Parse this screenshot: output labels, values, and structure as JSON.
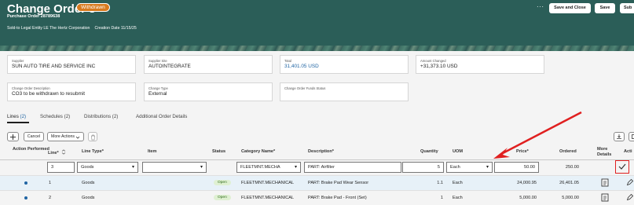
{
  "header": {
    "title": "Change Order 3",
    "badge": "Withdrawn",
    "purchase_order": "Purchase Order 28789638",
    "meta_legal": "Sold-to Legal Entity LE The Hertz Corporation",
    "meta_date": "Creation Date 11/15/25",
    "more_label": "···",
    "save_close_label": "Save and Close",
    "save_label": "Save",
    "submit_label": "Sub"
  },
  "summary": {
    "supplier_label": "Supplier",
    "supplier_value": "SUN AUTO TIRE AND SERVICE INC",
    "site_label": "Supplier Site",
    "site_value": "AUTOINTEGRATE",
    "total_label": "Total",
    "total_value": "31,401.05 USD",
    "amount_label": "Amount Changed",
    "amount_value": "+31,373.10 USD",
    "desc_label": "Change Order Description",
    "desc_value": "CO3 to be withdrawn to resubmit",
    "type_label": "Change Type",
    "type_value": "External",
    "funds_label": "Change Order Funds Status",
    "funds_value": ""
  },
  "tabs": [
    {
      "label": "Lines",
      "count": "(2)"
    },
    {
      "label": "Schedules",
      "count": "(2)"
    },
    {
      "label": "Distributions",
      "count": "(2)"
    },
    {
      "label": "Additional Order Details",
      "count": ""
    }
  ],
  "toolbar": {
    "add_icon": "plus-icon",
    "cancel_label": "Cancel",
    "more_actions_label": "More Actions",
    "delete_icon": "trash-icon"
  },
  "columns": {
    "action_performed": "Action Performed",
    "line": "Line*",
    "line_type": "Line Type*",
    "item": "Item",
    "status": "Status",
    "category": "Category Name*",
    "description": "Description*",
    "quantity": "Quantity",
    "uom": "UOM",
    "price": "Price*",
    "ordered": "Ordered",
    "more_details": "More Details",
    "actions": "Acti"
  },
  "edit_row": {
    "line": "3",
    "line_type": "Goods",
    "item": "",
    "category": "FLEETMNT.MECHA",
    "description": "PART: Airfilter",
    "quantity": "5",
    "uom": "Each",
    "price": "50.00",
    "ordered": "250.00"
  },
  "rows": [
    {
      "line": "1",
      "line_type": "Goods",
      "status": "Open",
      "category": "FLEETMNT.MECHANICAL",
      "description": "PART: Brake Pad Wear Sensor",
      "quantity": "1.1",
      "uom": "Each",
      "price": "24,000.95",
      "ordered": "26,401.05"
    },
    {
      "line": "2",
      "line_type": "Goods",
      "status": "Open",
      "category": "FLEETMNT.MECHANICAL",
      "description": "PART: Brake Pad - Front (Set)",
      "quantity": "1",
      "uom": "Each",
      "price": "5,000.00",
      "ordered": "5,000.00"
    }
  ],
  "colors": {
    "header_bg": "#2b5e58",
    "badge": "#d77a1e",
    "link": "#1f64a3",
    "annotation": "#e02020"
  }
}
